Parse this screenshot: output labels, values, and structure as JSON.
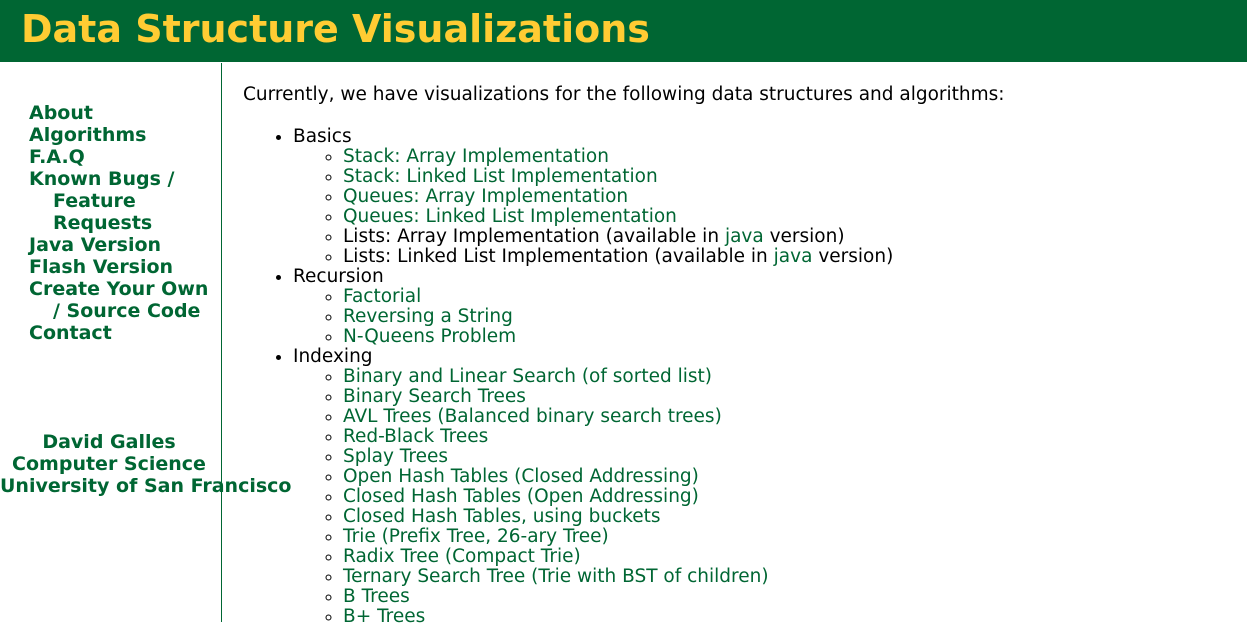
{
  "header": {
    "title": "Data Structure Visualizations"
  },
  "sidebar": {
    "nav": [
      {
        "label": "About"
      },
      {
        "label": "Algorithms"
      },
      {
        "label": "F.A.Q"
      },
      {
        "label": "Known Bugs / Feature Requests"
      },
      {
        "label": "Java Version"
      },
      {
        "label": "Flash Version"
      },
      {
        "label": "Create Your Own / Source Code"
      },
      {
        "label": "Contact"
      }
    ],
    "author": {
      "name": "David Galles",
      "department": "Computer Science",
      "university": "University of San Francisco"
    }
  },
  "main": {
    "intro": "Currently, we have visualizations for the following data structures and algorithms:",
    "categories": [
      {
        "label": "Basics",
        "items": [
          {
            "link": "Stack: Array Implementation"
          },
          {
            "link": "Stack: Linked List Implementation"
          },
          {
            "link": "Queues: Array Implementation"
          },
          {
            "link": "Queues: Linked List Implementation"
          },
          {
            "prefix": "Lists: Array Implementation (available in ",
            "link": "java",
            "suffix": " version)"
          },
          {
            "prefix": "Lists: Linked List Implementation (available in ",
            "link": "java",
            "suffix": " version)"
          }
        ]
      },
      {
        "label": "Recursion",
        "items": [
          {
            "link": "Factorial"
          },
          {
            "link": "Reversing a String"
          },
          {
            "link": "N-Queens Problem"
          }
        ]
      },
      {
        "label": "Indexing",
        "items": [
          {
            "link": "Binary and Linear Search (of sorted list)"
          },
          {
            "link": "Binary Search Trees"
          },
          {
            "link": "AVL Trees (Balanced binary search trees)"
          },
          {
            "link": "Red-Black Trees"
          },
          {
            "link": "Splay Trees"
          },
          {
            "link": "Open Hash Tables (Closed Addressing)"
          },
          {
            "link": "Closed Hash Tables (Open Addressing)"
          },
          {
            "link": "Closed Hash Tables, using buckets"
          },
          {
            "link": "Trie (Prefix Tree, 26-ary Tree)"
          },
          {
            "link": "Radix Tree (Compact Trie)"
          },
          {
            "link": "Ternary Search Tree (Trie with BST of children)"
          },
          {
            "link": "B Trees"
          },
          {
            "link": "B+ Trees"
          }
        ]
      }
    ]
  },
  "colors": {
    "header_bg": "#006633",
    "title": "#ffcc33",
    "link": "#006633",
    "text": "#000000"
  }
}
